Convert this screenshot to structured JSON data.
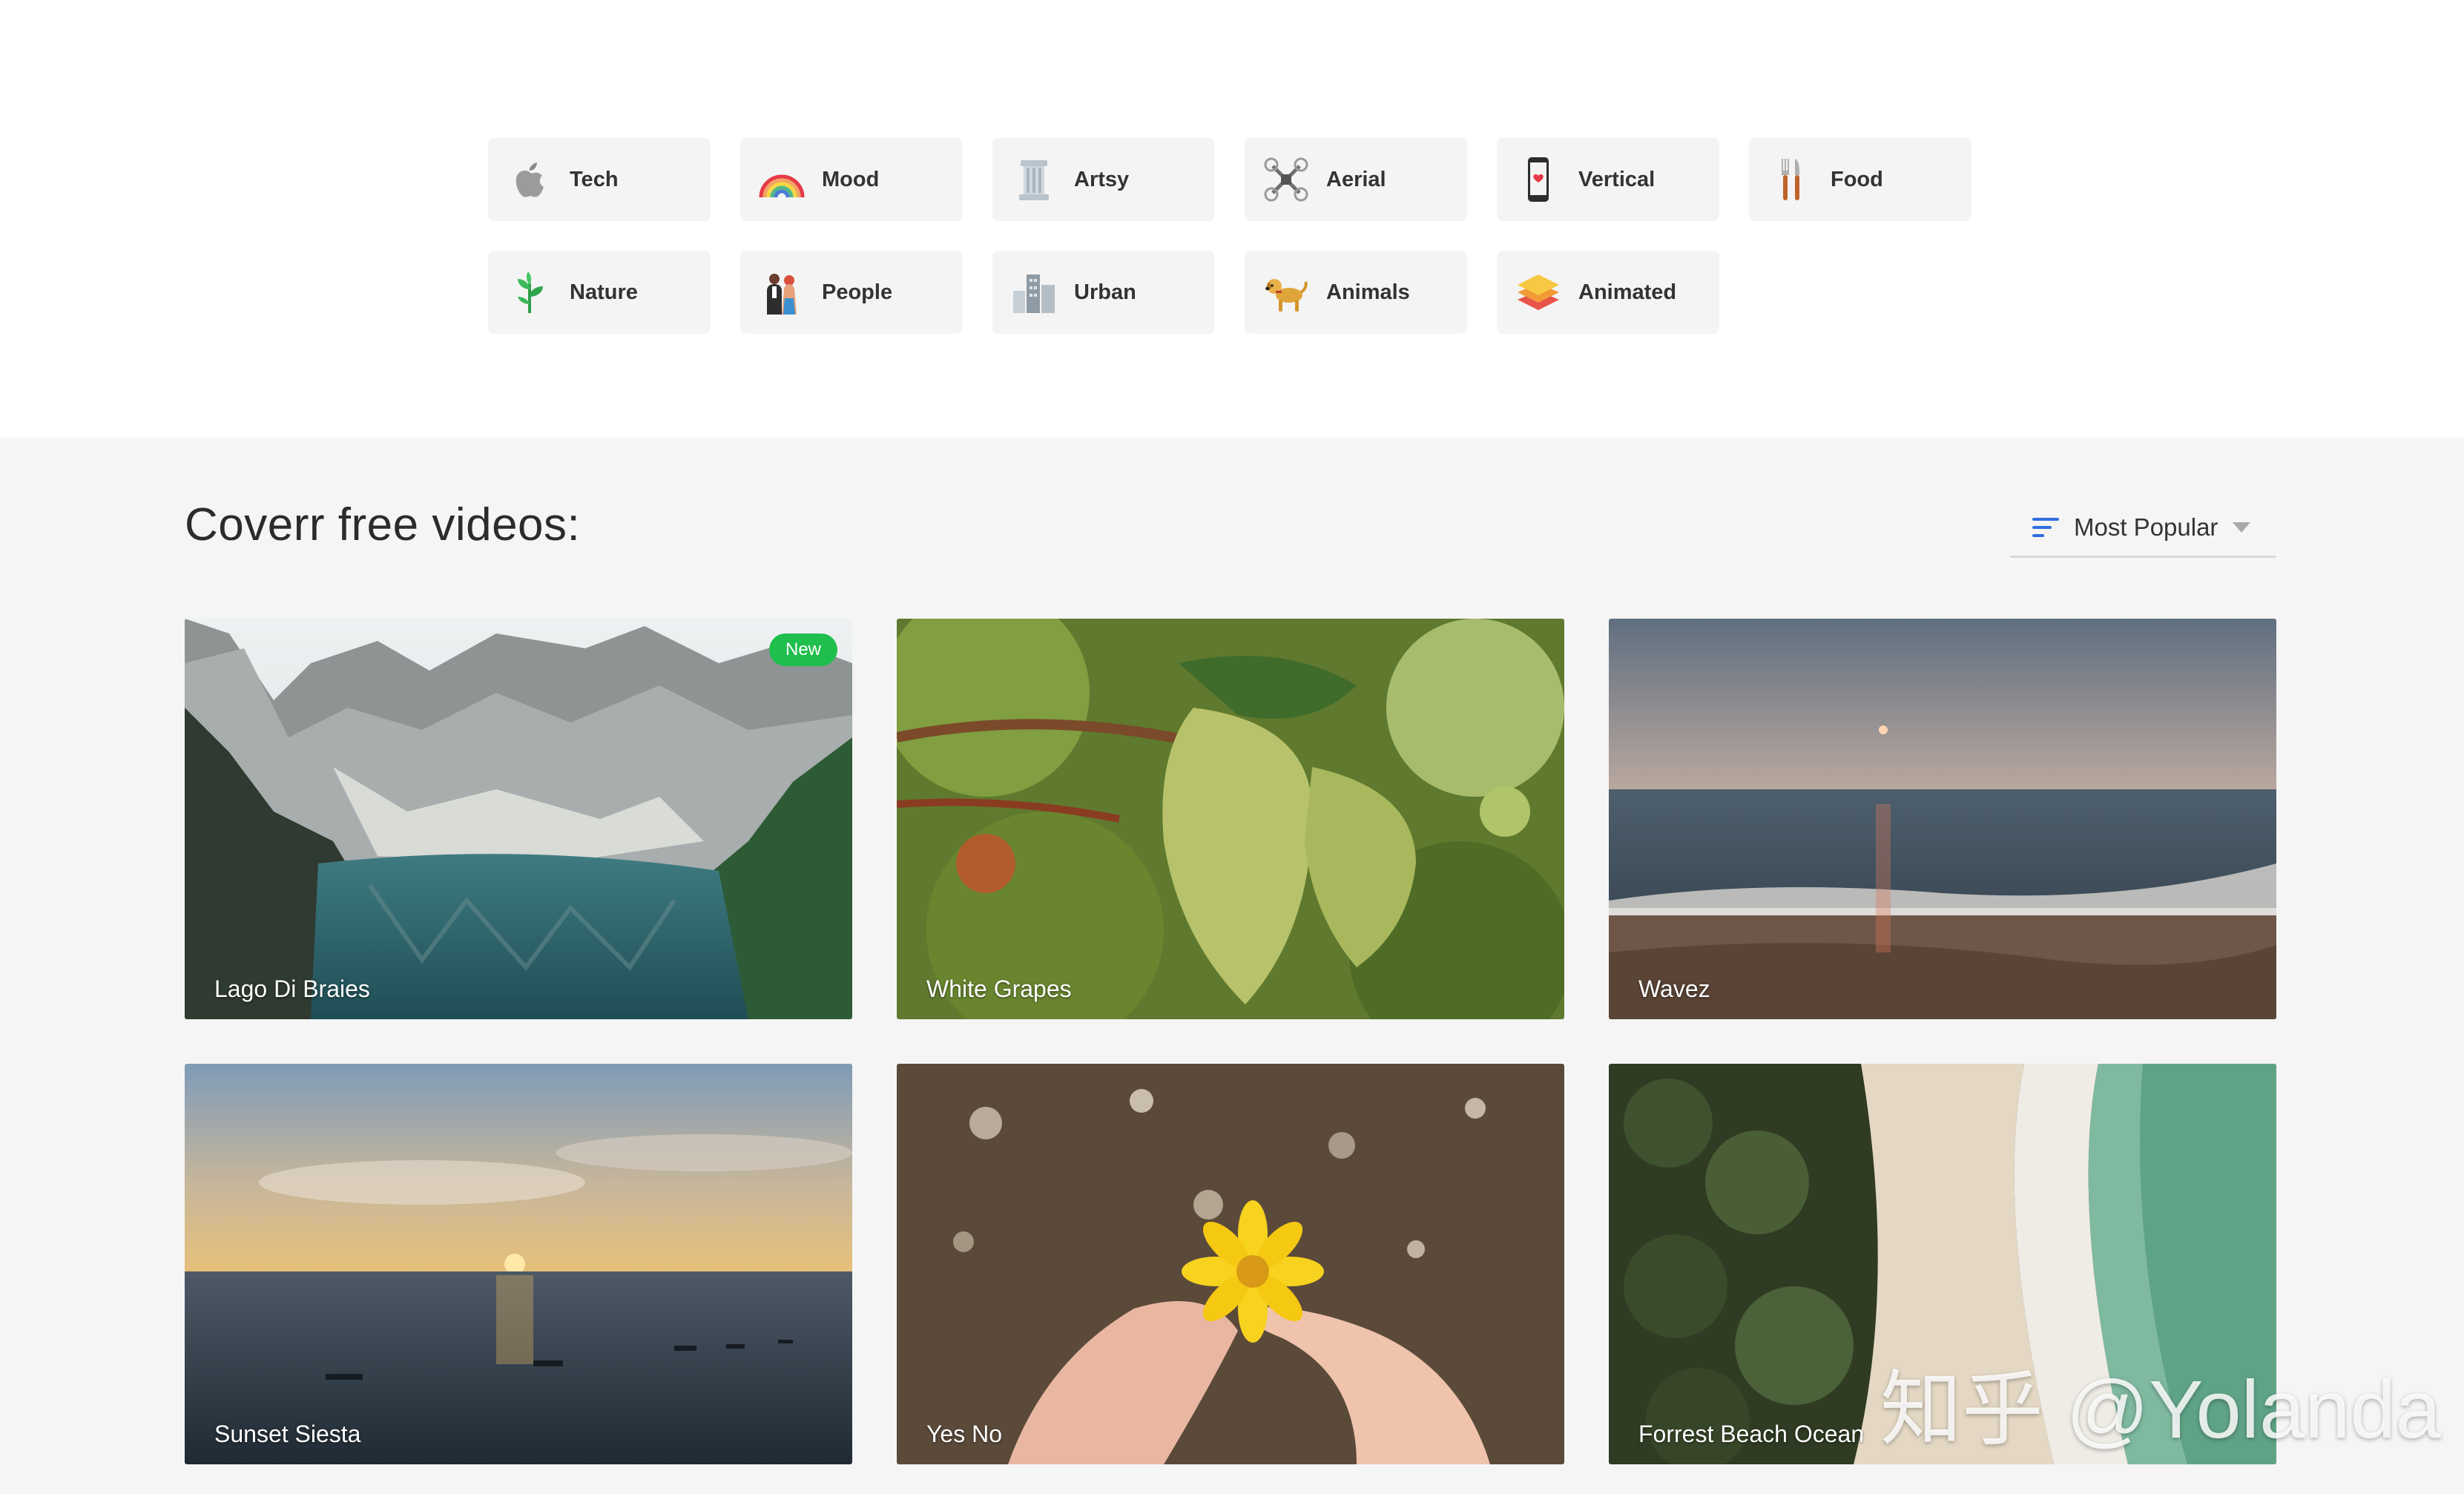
{
  "categories": [
    {
      "label": "Tech",
      "icon": "apple-icon"
    },
    {
      "label": "Mood",
      "icon": "rainbow-icon"
    },
    {
      "label": "Artsy",
      "icon": "column-icon"
    },
    {
      "label": "Aerial",
      "icon": "drone-icon"
    },
    {
      "label": "Vertical",
      "icon": "phone-icon"
    },
    {
      "label": "Food",
      "icon": "utensils-icon"
    },
    {
      "label": "Nature",
      "icon": "plant-icon"
    },
    {
      "label": "People",
      "icon": "couple-icon"
    },
    {
      "label": "Urban",
      "icon": "buildings-icon"
    },
    {
      "label": "Animals",
      "icon": "dog-icon"
    },
    {
      "label": "Animated",
      "icon": "layers-icon"
    }
  ],
  "videos": {
    "heading": "Coverr free videos:",
    "sort_label": "Most Popular",
    "sort_icon": "sort-lines-icon",
    "items": [
      {
        "title": "Lago Di Braies",
        "badge": "New"
      },
      {
        "title": "White Grapes"
      },
      {
        "title": "Wavez"
      },
      {
        "title": "Sunset Siesta"
      },
      {
        "title": "Yes No"
      },
      {
        "title": "Forrest Beach Ocean"
      }
    ]
  },
  "watermark": "知乎 @Yolanda",
  "colors": {
    "badge_green": "#1fbf4d",
    "sort_icon_blue": "#2f6fe0",
    "category_bg": "#f4f4f4",
    "section_bg": "#f5f5f5"
  }
}
